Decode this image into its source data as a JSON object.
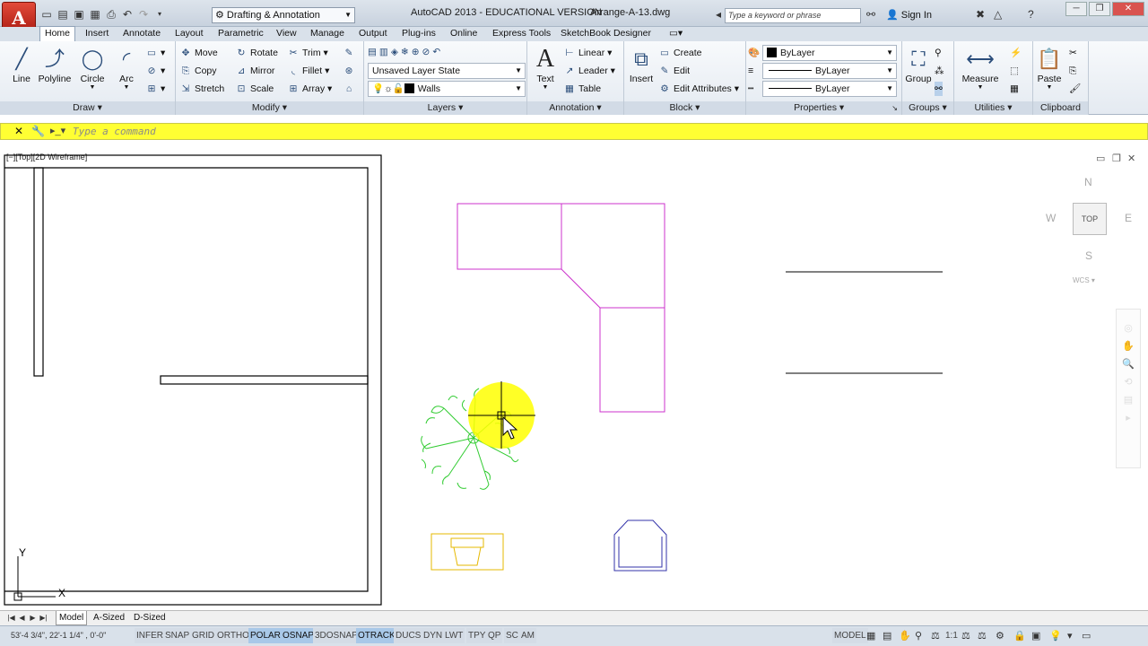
{
  "app": {
    "button_letter": "A",
    "title": "AutoCAD 2013 - EDUCATIONAL VERSION",
    "file": "Arrange-A-13.dwg",
    "workspace": "Drafting & Annotation",
    "search_placeholder": "Type a keyword or phrase",
    "sign_in": "Sign In"
  },
  "tabs": [
    "Home",
    "Insert",
    "Annotate",
    "Layout",
    "Parametric",
    "View",
    "Manage",
    "Output",
    "Plug-ins",
    "Online",
    "Express Tools",
    "SketchBook Designer"
  ],
  "panels": {
    "draw": {
      "title": "Draw",
      "line": "Line",
      "polyline": "Polyline",
      "circle": "Circle",
      "arc": "Arc"
    },
    "modify": {
      "title": "Modify",
      "move": "Move",
      "rotate": "Rotate",
      "trim": "Trim",
      "copy": "Copy",
      "mirror": "Mirror",
      "fillet": "Fillet",
      "stretch": "Stretch",
      "scale": "Scale",
      "array": "Array"
    },
    "layers": {
      "title": "Layers",
      "layer_state": "Unsaved Layer State",
      "current_layer": "Walls"
    },
    "annotation": {
      "title": "Annotation",
      "text": "Text",
      "linear": "Linear",
      "leader": "Leader",
      "table": "Table"
    },
    "block": {
      "title": "Block",
      "insert": "Insert",
      "create": "Create",
      "edit": "Edit",
      "edit_attributes": "Edit Attributes"
    },
    "properties": {
      "title": "Properties",
      "color": "ByLayer",
      "linetype": "ByLayer",
      "lineweight": "ByLayer"
    },
    "groups": {
      "title": "Groups",
      "group": "Group"
    },
    "utilities": {
      "title": "Utilities",
      "measure": "Measure"
    },
    "clipboard": {
      "title": "Clipboard",
      "paste": "Paste"
    }
  },
  "command_line": {
    "placeholder": "Type a command"
  },
  "viewport": {
    "label": "[−][Top][2D Wireframe]"
  },
  "viewcube": {
    "n": "N",
    "s": "S",
    "e": "E",
    "w": "W",
    "top": "TOP",
    "wcs": "WCS"
  },
  "ucs": {
    "x": "X",
    "y": "Y"
  },
  "layout_tabs": [
    "Model",
    "A-Sized",
    "D-Sized"
  ],
  "status": {
    "coords": "53'-4 3/4\",  22'-1 1/4\" , 0'-0\"",
    "toggles": [
      {
        "label": "INFER",
        "on": false
      },
      {
        "label": "SNAP",
        "on": false
      },
      {
        "label": "GRID",
        "on": false
      },
      {
        "label": "ORTHO",
        "on": false
      },
      {
        "label": "POLAR",
        "on": true
      },
      {
        "label": "OSNAP",
        "on": true
      },
      {
        "label": "3DOSNAP",
        "on": false
      },
      {
        "label": "OTRACK",
        "on": true
      },
      {
        "label": "DUCS",
        "on": false
      },
      {
        "label": "DYN",
        "on": false
      },
      {
        "label": "LWT",
        "on": false
      },
      {
        "label": "TPY",
        "on": false
      },
      {
        "label": "QP",
        "on": false
      },
      {
        "label": "SC",
        "on": false
      },
      {
        "label": "AM",
        "on": false
      }
    ],
    "model": "MODEL",
    "annotation_scale": "1:1"
  },
  "colors": {
    "furniture": "#cc33cc",
    "plant": "#33cc33",
    "toilet": "#e6b800",
    "chair": "#3333aa",
    "command_bar": "#ffff33",
    "highlight": "#ffff00"
  }
}
